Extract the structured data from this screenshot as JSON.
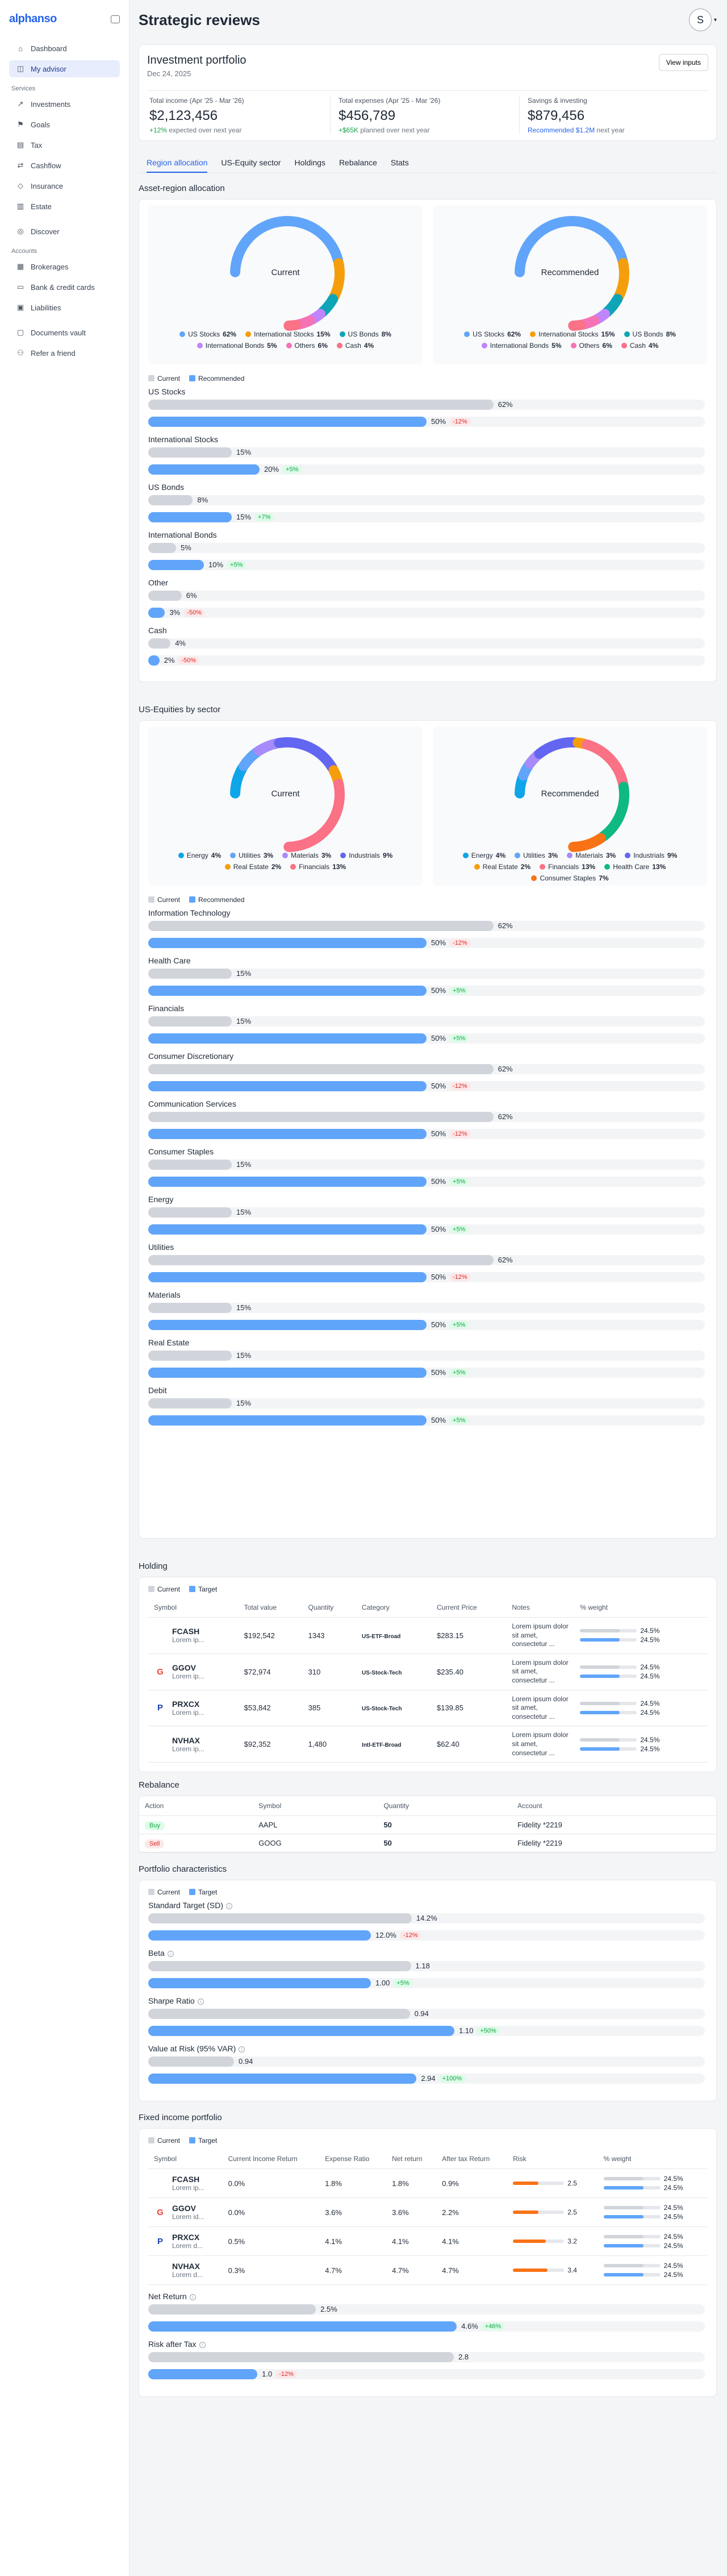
{
  "brand": {
    "name": "alphanso"
  },
  "sidebar": {
    "top": [
      {
        "icon": "home-icon",
        "glyph": "⌂",
        "label": "Dashboard"
      },
      {
        "icon": "advisor-icon",
        "glyph": "◫",
        "label": "My advisor"
      }
    ],
    "services_label": "Services",
    "services": [
      {
        "icon": "trend-icon",
        "glyph": "↗",
        "label": "Investments"
      },
      {
        "icon": "flag-icon",
        "glyph": "⚑",
        "label": "Goals"
      },
      {
        "icon": "tax-icon",
        "glyph": "▤",
        "label": "Tax"
      },
      {
        "icon": "cashflow-icon",
        "glyph": "⇄",
        "label": "Cashflow"
      },
      {
        "icon": "shield-icon",
        "glyph": "◇",
        "label": "Insurance"
      },
      {
        "icon": "estate-icon",
        "glyph": "▥",
        "label": "Estate"
      }
    ],
    "discover": {
      "icon": "compass-icon",
      "glyph": "◎",
      "label": "Discover"
    },
    "accounts_label": "Accounts",
    "accounts": [
      {
        "icon": "brokerage-icon",
        "glyph": "▦",
        "label": "Brokerages"
      },
      {
        "icon": "card-icon",
        "glyph": "▭",
        "label": "Bank & credit cards"
      },
      {
        "icon": "liability-icon",
        "glyph": "▣",
        "label": "Liabilities"
      }
    ],
    "bottom": [
      {
        "icon": "docs-icon",
        "glyph": "▢",
        "label": "Documents vault"
      },
      {
        "icon": "gift-icon",
        "glyph": "⚇",
        "label": "Refer a friend"
      }
    ]
  },
  "header": {
    "title": "Strategic reviews",
    "avatar": "S"
  },
  "portfolio": {
    "title": "Investment portfolio",
    "date": "Dec 24, 2025",
    "inputs_button": "View inputs",
    "stats": [
      {
        "label": "Total income (Apr '25 - Mar '26)",
        "value": "$2,123,456",
        "hl": "+12%",
        "rest": " expected over next year",
        "hlclass": "g"
      },
      {
        "label": "Total expenses (Apr '25 - Mar '26)",
        "value": "$456,789",
        "hl": "+$65K",
        "rest": " planned over next year",
        "hlclass": "g"
      },
      {
        "label": "Savings & investing",
        "value": "$879,456",
        "hl": "Recommended $1.2M",
        "rest": " next year",
        "hlclass": "b"
      }
    ]
  },
  "tabs": [
    "Region allocation",
    "US-Equity sector",
    "Holdings",
    "Rebalance",
    "Stats"
  ],
  "keys": {
    "current": "Current",
    "recommended": "Recommended",
    "target": "Target"
  },
  "region": {
    "title": "Asset-region allocation",
    "current_label": "Current",
    "recommended_label": "Recommended",
    "legend": [
      {
        "name": "US Stocks",
        "pct": "62%",
        "color": "#60a5fa"
      },
      {
        "name": "International Stocks",
        "pct": "15%",
        "color": "#f59e0b"
      },
      {
        "name": "US Bonds",
        "pct": "8%",
        "color": "#0ea5b7"
      },
      {
        "name": "International Bonds",
        "pct": "5%",
        "color": "#c084fc"
      },
      {
        "name": "Others",
        "pct": "6%",
        "color": "#f472b6"
      },
      {
        "name": "Cash",
        "pct": "4%",
        "color": "#fb7185"
      }
    ],
    "rows": [
      {
        "label": "US Stocks",
        "current": 62,
        "current_txt": "62%",
        "target": 50,
        "target_txt": "50%",
        "delta": "-12%",
        "sign": "neg"
      },
      {
        "label": "International Stocks",
        "current": 15,
        "current_txt": "15%",
        "target": 20,
        "target_txt": "20%",
        "delta": "+5%",
        "sign": "pos"
      },
      {
        "label": "US Bonds",
        "current": 8,
        "current_txt": "8%",
        "target": 15,
        "target_txt": "15%",
        "delta": "+7%",
        "sign": "pos"
      },
      {
        "label": "International Bonds",
        "current": 5,
        "current_txt": "5%",
        "target": 10,
        "target_txt": "10%",
        "delta": "+5%",
        "sign": "pos"
      },
      {
        "label": "Other",
        "current": 6,
        "current_txt": "6%",
        "target": 3,
        "target_txt": "3%",
        "delta": "-50%",
        "sign": "neg"
      },
      {
        "label": "Cash",
        "current": 4,
        "current_txt": "4%",
        "target": 2,
        "target_txt": "2%",
        "delta": "-50%",
        "sign": "neg"
      }
    ]
  },
  "sector": {
    "title": "US-Equities by sector",
    "current_label": "Current",
    "recommended_label": "Recommended",
    "legend_current": [
      {
        "name": "Energy",
        "pct": "4%",
        "color": "#0ea5e9"
      },
      {
        "name": "Utilities",
        "pct": "3%",
        "color": "#60a5fa"
      },
      {
        "name": "Materials",
        "pct": "3%",
        "color": "#a78bfa"
      },
      {
        "name": "Industrials",
        "pct": "9%",
        "color": "#6366f1"
      },
      {
        "name": "Real Estate",
        "pct": "2%",
        "color": "#f59e0b"
      },
      {
        "name": "Financials",
        "pct": "13%",
        "color": "#fb7185"
      }
    ],
    "legend_recommended": [
      {
        "name": "Energy",
        "pct": "4%",
        "color": "#0ea5e9"
      },
      {
        "name": "Utilities",
        "pct": "3%",
        "color": "#60a5fa"
      },
      {
        "name": "Materials",
        "pct": "3%",
        "color": "#a78bfa"
      },
      {
        "name": "Industrials",
        "pct": "9%",
        "color": "#6366f1"
      },
      {
        "name": "Real Estate",
        "pct": "2%",
        "color": "#f59e0b"
      },
      {
        "name": "Financials",
        "pct": "13%",
        "color": "#fb7185"
      },
      {
        "name": "Health Care",
        "pct": "13%",
        "color": "#10b981"
      },
      {
        "name": "Consumer Staples",
        "pct": "7%",
        "color": "#f97316"
      }
    ],
    "rows": [
      {
        "label": "Information Technology",
        "current": 62,
        "current_txt": "62%",
        "target": 50,
        "target_txt": "50%",
        "delta": "-12%",
        "sign": "neg"
      },
      {
        "label": "Health Care",
        "current": 15,
        "current_txt": "15%",
        "target": 50,
        "target_txt": "50%",
        "delta": "+5%",
        "sign": "pos"
      },
      {
        "label": "Financials",
        "current": 15,
        "current_txt": "15%",
        "target": 50,
        "target_txt": "50%",
        "delta": "+5%",
        "sign": "pos"
      },
      {
        "label": "Consumer Discretionary",
        "current": 62,
        "current_txt": "62%",
        "target": 50,
        "target_txt": "50%",
        "delta": "-12%",
        "sign": "neg"
      },
      {
        "label": "Communication Services",
        "current": 62,
        "current_txt": "62%",
        "target": 50,
        "target_txt": "50%",
        "delta": "-12%",
        "sign": "neg"
      },
      {
        "label": "Consumer Staples",
        "current": 15,
        "current_txt": "15%",
        "target": 50,
        "target_txt": "50%",
        "delta": "+5%",
        "sign": "pos"
      },
      {
        "label": "Energy",
        "current": 15,
        "current_txt": "15%",
        "target": 50,
        "target_txt": "50%",
        "delta": "+5%",
        "sign": "pos"
      },
      {
        "label": "Utilities",
        "current": 62,
        "current_txt": "62%",
        "target": 50,
        "target_txt": "50%",
        "delta": "-12%",
        "sign": "neg"
      },
      {
        "label": "Materials",
        "current": 15,
        "current_txt": "15%",
        "target": 50,
        "target_txt": "50%",
        "delta": "+5%",
        "sign": "pos"
      },
      {
        "label": "Real Estate",
        "current": 15,
        "current_txt": "15%",
        "target": 50,
        "target_txt": "50%",
        "delta": "+5%",
        "sign": "pos"
      },
      {
        "label": "Debit",
        "current": 15,
        "current_txt": "15%",
        "target": 50,
        "target_txt": "50%",
        "delta": "+5%",
        "sign": "pos"
      }
    ]
  },
  "holding": {
    "title": "Holding",
    "headers": [
      "Symbol",
      "Total value",
      "Quantity",
      "Category",
      "Current Price",
      "Notes",
      "% weight"
    ],
    "rows": [
      {
        "logo": "",
        "sym": "FCASH",
        "sub": "Lorem ip...",
        "value": "$192,542",
        "qty": "1343",
        "cat": "US-ETF-Broad",
        "price": "$283.15",
        "notes": "Lorem ipsum dolor sit amet, consectetur ...",
        "w1": "24.5%",
        "w2": "24.5%"
      },
      {
        "logo": "G",
        "sym": "GGOV",
        "sub": "Lorem ip...",
        "value": "$72,974",
        "qty": "310",
        "cat": "US-Stock-Tech",
        "price": "$235.40",
        "notes": "Lorem ipsum dolor sit amet, consectetur ...",
        "w1": "24.5%",
        "w2": "24.5%"
      },
      {
        "logo": "P",
        "sym": "PRXCX",
        "sub": "Lorem ip...",
        "value": "$53,842",
        "qty": "385",
        "cat": "US-Stock-Tech",
        "price": "$139.85",
        "notes": "Lorem ipsum dolor sit amet, consectetur ...",
        "w1": "24.5%",
        "w2": "24.5%"
      },
      {
        "logo": "",
        "sym": "NVHAX",
        "sub": "Lorem ip...",
        "value": "$92,352",
        "qty": "1,480",
        "cat": "Intl-ETF-Broad",
        "price": "$62.40",
        "notes": "Lorem ipsum dolor sit amet, consectetur ...",
        "w1": "24.5%",
        "w2": "24.5%"
      }
    ]
  },
  "rebalance": {
    "title": "Rebalance",
    "headers": [
      "Action",
      "Symbol",
      "Quantity",
      "Account"
    ],
    "rows": [
      {
        "action": "Buy",
        "cls": "buy",
        "sym": "AAPL",
        "qty": "50",
        "acct": "Fidelity *2219"
      },
      {
        "action": "Sell",
        "cls": "sell",
        "sym": "GOOG",
        "qty": "50",
        "acct": "Fidelity *2219"
      }
    ]
  },
  "characteristics": {
    "title": "Portfolio characteristics",
    "rows": [
      {
        "label": "Standard Target (SD)",
        "current": 14.2,
        "current_txt": "14.2%",
        "target": 12.0,
        "target_txt": "12.0%",
        "delta": "-12%",
        "sign": "neg",
        "scale": 30
      },
      {
        "label": "Beta",
        "current": 1.18,
        "current_txt": "1.18",
        "target": 1.0,
        "target_txt": "1.00",
        "delta": "+5%",
        "sign": "pos",
        "scale": 2.5
      },
      {
        "label": "Sharpe Ratio",
        "current": 0.94,
        "current_txt": "0.94",
        "target": 1.1,
        "target_txt": "1.10",
        "delta": "+50%",
        "sign": "pos",
        "scale": 2.0
      },
      {
        "label": "Value at Risk (95% VAR)",
        "current": 0.94,
        "current_txt": "0.94",
        "target": 2.94,
        "target_txt": "2.94",
        "delta": "+100%",
        "sign": "pos",
        "scale": 6.1
      }
    ]
  },
  "fixed": {
    "title": "Fixed income portfolio",
    "headers": [
      "Symbol",
      "Current Income Return",
      "Expense Ratio",
      "Net return",
      "After tax Return",
      "Risk",
      "% weight"
    ],
    "rows": [
      {
        "logo": "",
        "sym": "FCASH",
        "sub": "Lorem ip...",
        "cir": "0.0%",
        "er": "1.8%",
        "nr": "1.8%",
        "atr": "0.9%",
        "risk": 2.5,
        "risk_txt": "2.5",
        "w1": "24.5%",
        "w2": "24.5%"
      },
      {
        "logo": "G",
        "sym": "GGOV",
        "sub": "Lorem id...",
        "cir": "0.0%",
        "er": "3.6%",
        "nr": "3.6%",
        "atr": "2.2%",
        "risk": 2.5,
        "risk_txt": "2.5",
        "w1": "24.5%",
        "w2": "24.5%"
      },
      {
        "logo": "P",
        "sym": "PRXCX",
        "sub": "Lorem d...",
        "cir": "0.5%",
        "er": "4.1%",
        "nr": "4.1%",
        "atr": "4.1%",
        "risk": 3.2,
        "risk_txt": "3.2",
        "w1": "24.5%",
        "w2": "24.5%"
      },
      {
        "logo": "",
        "sym": "NVHAX",
        "sub": "Lorem d...",
        "cir": "0.3%",
        "er": "4.7%",
        "nr": "4.7%",
        "atr": "4.7%",
        "risk": 3.4,
        "risk_txt": "3.4",
        "w1": "24.5%",
        "w2": "24.5%"
      }
    ],
    "bars": [
      {
        "label": "Net Return",
        "current": 2.5,
        "current_txt": "2.5%",
        "target": 4.6,
        "target_txt": "4.6%",
        "delta": "+46%",
        "sign": "pos",
        "scale": 8.3
      },
      {
        "label": "Risk after Tax",
        "current": 2.8,
        "current_txt": "2.8",
        "target": 1.0,
        "target_txt": "1.0",
        "delta": "-12%",
        "sign": "neg",
        "scale": 5.1
      }
    ]
  }
}
